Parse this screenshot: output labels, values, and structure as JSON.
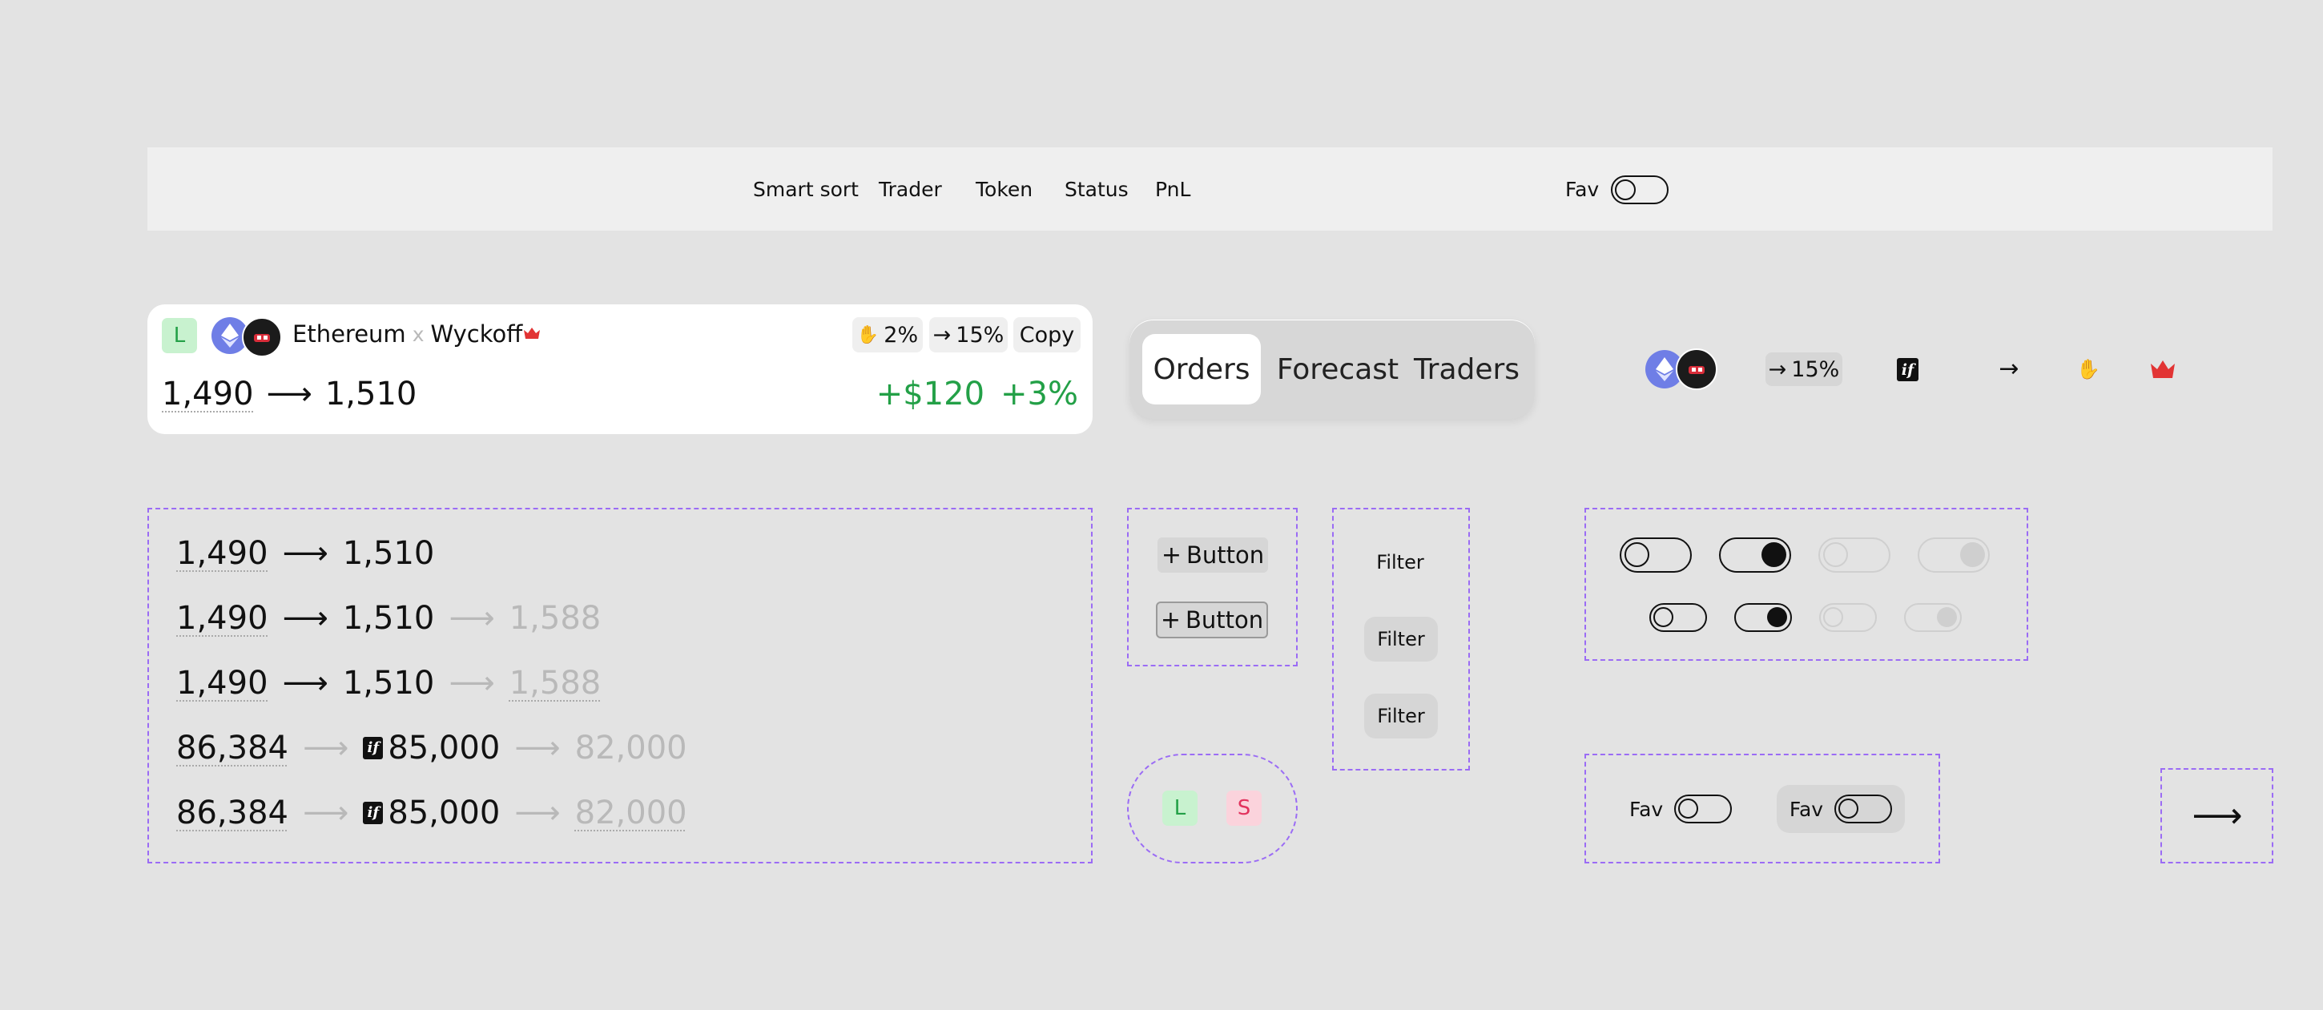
{
  "header": {
    "nav": [
      "Smart sort",
      "Trader",
      "Token",
      "Status",
      "PnL"
    ],
    "fav_label": "Fav"
  },
  "card": {
    "side": "L",
    "token": "Ethereum",
    "separator": "x",
    "trader": "Wyckoff",
    "chip_hand": "2%",
    "chip_arrow": "15%",
    "copy_label": "Copy",
    "entry": "1,490",
    "current": "1,510",
    "pnl_usd": "+$120",
    "pnl_pct": "+3%"
  },
  "tabs": {
    "items": [
      "Orders",
      "Forecast",
      "Traders"
    ],
    "active": "Orders"
  },
  "icons_row": {
    "chip_arrow": "15%",
    "if_label": "if"
  },
  "price_rows": [
    {
      "a": "1,490",
      "b": "1,510"
    },
    {
      "a": "1,490",
      "b": "1,510",
      "c": "1,588"
    },
    {
      "a": "1,490",
      "b": "1,510",
      "c": "1,588"
    },
    {
      "a": "86,384",
      "b": "85,000",
      "c": "82,000"
    },
    {
      "a": "86,384",
      "b": "85,000",
      "c": "82,000"
    }
  ],
  "buttons": {
    "label": "Button"
  },
  "filters": {
    "label": "Filter"
  },
  "side_badges": {
    "long": "L",
    "short": "S"
  },
  "fav_toggles": {
    "label": "Fav"
  },
  "colors": {
    "background": "#e3e3e3",
    "accent_green": "#23a047",
    "long_bg": "#c8f2cf",
    "short_bg": "#fbd3dc",
    "short_text": "#e2335e",
    "dashed_frame": "#9b6cf5",
    "crown": "#e23434",
    "eth": "#6f7ee6"
  }
}
